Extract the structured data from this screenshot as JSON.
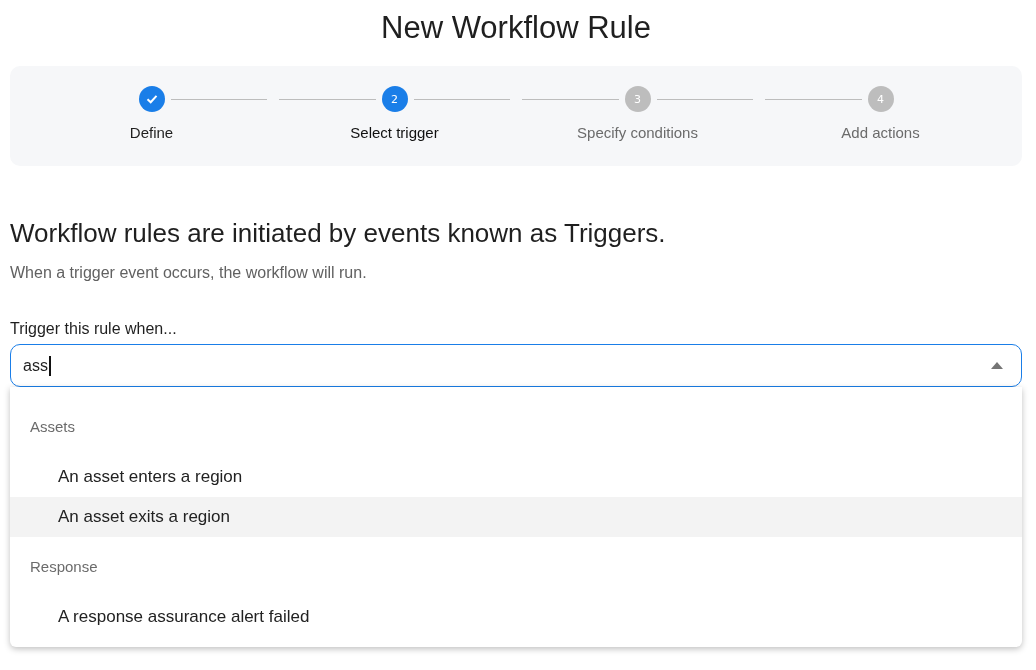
{
  "title": "New Workflow Rule",
  "steps": [
    {
      "label": "Define",
      "completed": true,
      "selected": false
    },
    {
      "number": "2",
      "label": "Select trigger",
      "completed": false,
      "selected": true
    },
    {
      "number": "3",
      "label": "Specify conditions",
      "completed": false,
      "selected": false
    },
    {
      "number": "4",
      "label": "Add actions",
      "completed": false,
      "selected": false
    }
  ],
  "heading": "Workflow rules are initiated by events known as Triggers.",
  "subheading": "When a trigger event occurs, the workflow will run.",
  "field": {
    "label": "Trigger this rule when...",
    "value": "ass",
    "expanded": true
  },
  "groups": [
    {
      "name": "Assets",
      "options": [
        {
          "label": "An asset enters a region",
          "selected": false
        },
        {
          "label": "An asset exits a region",
          "selected": true
        }
      ]
    },
    {
      "name": "Response",
      "options": [
        {
          "label": "A response assurance alert failed",
          "selected": false
        }
      ]
    }
  ]
}
